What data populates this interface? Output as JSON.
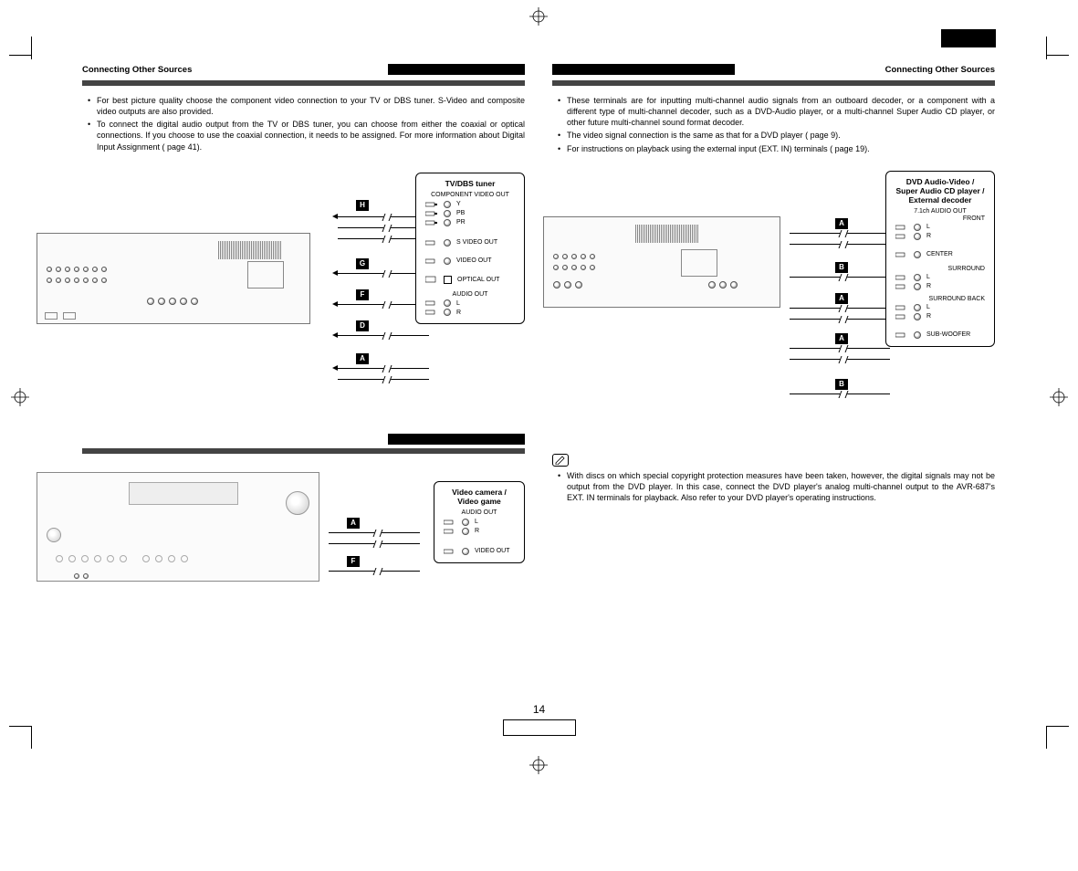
{
  "header": {
    "left_title": "Connecting Other Sources",
    "right_title": "Connecting Other Sources"
  },
  "left_col": {
    "bullets": [
      "For best picture quality choose the component video connection to your TV or DBS tuner. S-Video and composite video outputs are also provided.",
      "To connect the digital audio output from the TV or DBS tuner, you can choose from either the coaxial or optical connections. If you choose to use the coaxial connection, it needs to be assigned. For more information about Digital Input Assignment (        page 41)."
    ],
    "diagram1": {
      "source_title": "TV/DBS tuner",
      "groups": {
        "component": {
          "heading": "COMPONENT VIDEO OUT",
          "rows": [
            "Y",
            "PB",
            "PR"
          ]
        },
        "svideo": "S VIDEO OUT",
        "video": "VIDEO OUT",
        "optical": "OPTICAL OUT",
        "audio": {
          "heading": "AUDIO OUT",
          "rows": [
            "L",
            "R"
          ]
        }
      },
      "callouts": [
        "H",
        "G",
        "F",
        "D",
        "A"
      ]
    },
    "diagram2": {
      "source_title": "Video camera / Video game",
      "audio": {
        "heading": "AUDIO OUT",
        "rows": [
          "L",
          "R"
        ]
      },
      "video": "VIDEO OUT",
      "callouts": [
        "A",
        "F"
      ]
    }
  },
  "right_col": {
    "bullets": [
      "These terminals are for inputting multi-channel audio signals from an outboard decoder, or a component with a different type of multi-channel decoder, such as a DVD-Audio player, or a multi-channel Super Audio CD player, or other future multi-channel sound format decoder.",
      "The video signal connection is the same as that for a DVD player (        page 9).",
      "For instructions on playback using the external input (EXT. IN) terminals (        page 19)."
    ],
    "diagram": {
      "source_title": "DVD Audio-Video / Super Audio CD player / External decoder",
      "heading": "7.1ch AUDIO OUT",
      "rows": [
        {
          "group": "FRONT",
          "channels": [
            "L",
            "R"
          ]
        },
        {
          "group": "CENTER",
          "channels": [
            ""
          ]
        },
        {
          "group": "SURROUND",
          "channels": [
            "L",
            "R"
          ]
        },
        {
          "group": "SURROUND BACK",
          "channels": [
            "L",
            "R"
          ]
        },
        {
          "group": "SUB-WOOFER",
          "channels": [
            ""
          ]
        }
      ],
      "callouts": [
        "A",
        "B",
        "A",
        "A",
        "B"
      ]
    },
    "note": "With discs on which special copyright protection measures have been taken, however, the digital signals may not be output from the DVD player. In this case, connect the DVD player's analog multi-channel output to the AVR-687's EXT. IN terminals for playback. Also refer to your DVD player's operating instructions."
  },
  "page_number": "14"
}
